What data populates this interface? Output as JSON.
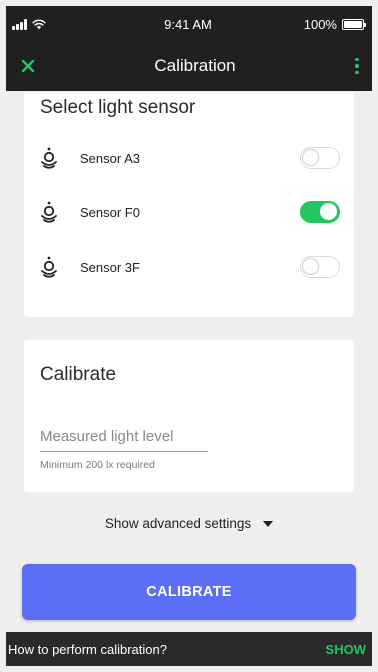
{
  "status_bar": {
    "time": "9:41 AM",
    "battery": "100%"
  },
  "app_bar": {
    "title": "Calibration",
    "close_icon": "close-icon",
    "more_icon": "more-vertical-icon"
  },
  "sensors_card": {
    "title": "Select light sensor",
    "items": [
      {
        "label": "Sensor A3",
        "enabled": false,
        "icon": "light-sensor-icon"
      },
      {
        "label": "Sensor F0",
        "enabled": true,
        "icon": "light-sensor-icon"
      },
      {
        "label": "Sensor 3F",
        "enabled": false,
        "icon": "light-sensor-icon"
      }
    ]
  },
  "calibrate_card": {
    "title": "Calibrate",
    "input_value": "",
    "input_placeholder": "Measured light level",
    "helper": "Minimum 200 lx required"
  },
  "advanced": {
    "label": "Show advanced settings"
  },
  "calibrate_button": {
    "label": "CALIBRATE"
  },
  "snackbar": {
    "message": "How to perform calibration?",
    "action": "SHOW"
  },
  "colors": {
    "accent_green": "#22c55e",
    "primary_blue": "#5b6ef5",
    "app_bar": "#202020",
    "background": "#efefef"
  }
}
